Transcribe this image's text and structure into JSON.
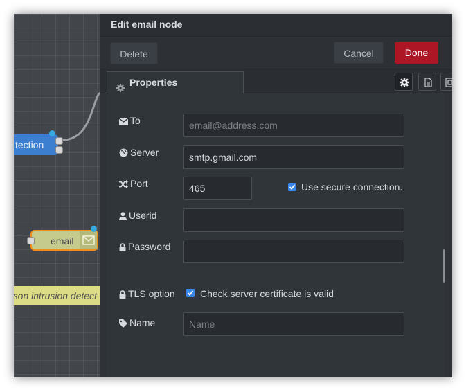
{
  "canvas": {
    "node_detect_label": "tection",
    "node_email_label": "email",
    "comment_label": "rson intrusion detect"
  },
  "tray": {
    "title": "Edit email node",
    "delete_label": "Delete",
    "cancel_label": "Cancel",
    "done_label": "Done",
    "tab_properties_label": "Properties"
  },
  "form": {
    "to_label": "To",
    "to_placeholder": "email@address.com",
    "server_label": "Server",
    "server_value": "smtp.gmail.com",
    "port_label": "Port",
    "port_value": "465",
    "secure_label": "Use secure connection.",
    "secure_checked": true,
    "userid_label": "Userid",
    "userid_value": "",
    "password_label": "Password",
    "password_value": "",
    "tls_label": "TLS option",
    "tls_check_label": "Check server certificate is valid",
    "tls_checked": true,
    "name_label": "Name",
    "name_placeholder": "Name"
  },
  "colors": {
    "done_button": "#ad1625",
    "checkbox": "#3a86e8",
    "detect_node": "#3c7fd1",
    "email_node": "#c5ca8d",
    "email_node_border": "#f08e1e",
    "comment_node": "#dcdb86"
  },
  "icons": [
    "envelope-icon",
    "globe-icon",
    "random-icon",
    "user-icon",
    "lock-icon",
    "tag-icon",
    "gear-icon",
    "file-icon",
    "expand-icon"
  ]
}
